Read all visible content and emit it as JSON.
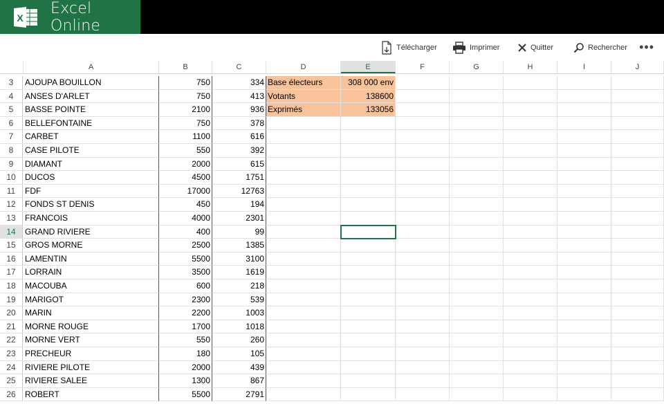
{
  "app": {
    "title": "Excel Online",
    "brand_color": "#217346"
  },
  "toolbar": {
    "download_label": "Télécharger",
    "print_label": "Imprimer",
    "quit_label": "Quitter",
    "search_label": "Rechercher",
    "more_label": "•••"
  },
  "sheet": {
    "columns": [
      "A",
      "B",
      "C",
      "D",
      "E",
      "F",
      "G",
      "H",
      "I",
      "J"
    ],
    "selected_cell": "E14",
    "rows": [
      {
        "n": "3",
        "a": "AJOUPA BOUILLON",
        "b": "750",
        "c": "334",
        "d": "Base électeurs",
        "e": "308 000 env"
      },
      {
        "n": "4",
        "a": "ANSES D'ARLET",
        "b": "750",
        "c": "413",
        "d": "Votants",
        "e": "138600"
      },
      {
        "n": "5",
        "a": "BASSE POINTE",
        "b": "2100",
        "c": "936",
        "d": "Exprimés",
        "e": "133056"
      },
      {
        "n": "6",
        "a": "BELLEFONTAINE",
        "b": "750",
        "c": "378",
        "d": "",
        "e": ""
      },
      {
        "n": "7",
        "a": "CARBET",
        "b": "1100",
        "c": "616",
        "d": "",
        "e": ""
      },
      {
        "n": "8",
        "a": "CASE PILOTE",
        "b": "550",
        "c": "392",
        "d": "",
        "e": ""
      },
      {
        "n": "9",
        "a": "DIAMANT",
        "b": "2000",
        "c": "615",
        "d": "",
        "e": ""
      },
      {
        "n": "10",
        "a": "DUCOS",
        "b": "4500",
        "c": "1751",
        "d": "",
        "e": ""
      },
      {
        "n": "11",
        "a": "FDF",
        "b": "17000",
        "c": "12763",
        "d": "",
        "e": ""
      },
      {
        "n": "12",
        "a": "FONDS ST DENIS",
        "b": "450",
        "c": "194",
        "d": "",
        "e": ""
      },
      {
        "n": "13",
        "a": "FRANCOIS",
        "b": "4000",
        "c": "2301",
        "d": "",
        "e": ""
      },
      {
        "n": "14",
        "a": "GRAND RIVIERE",
        "b": "400",
        "c": "99",
        "d": "",
        "e": ""
      },
      {
        "n": "15",
        "a": "GROS MORNE",
        "b": "2500",
        "c": "1385",
        "d": "",
        "e": ""
      },
      {
        "n": "16",
        "a": "LAMENTIN",
        "b": "5500",
        "c": "3100",
        "d": "",
        "e": ""
      },
      {
        "n": "17",
        "a": "LORRAIN",
        "b": "3500",
        "c": "1619",
        "d": "",
        "e": ""
      },
      {
        "n": "18",
        "a": "MACOUBA",
        "b": "600",
        "c": "218",
        "d": "",
        "e": ""
      },
      {
        "n": "19",
        "a": "MARIGOT",
        "b": "2300",
        "c": "539",
        "d": "",
        "e": ""
      },
      {
        "n": "20",
        "a": "MARIN",
        "b": "2200",
        "c": "1003",
        "d": "",
        "e": ""
      },
      {
        "n": "21",
        "a": "MORNE ROUGE",
        "b": "1700",
        "c": "1018",
        "d": "",
        "e": ""
      },
      {
        "n": "22",
        "a": "MORNE VERT",
        "b": "550",
        "c": "260",
        "d": "",
        "e": ""
      },
      {
        "n": "23",
        "a": "PRECHEUR",
        "b": "180",
        "c": "105",
        "d": "",
        "e": ""
      },
      {
        "n": "24",
        "a": "RIVIERE PILOTE",
        "b": "2000",
        "c": "439",
        "d": "",
        "e": ""
      },
      {
        "n": "25",
        "a": "RIVIERE SALEE",
        "b": "1300",
        "c": "867",
        "d": "",
        "e": ""
      },
      {
        "n": "26",
        "a": "ROBERT",
        "b": "5500",
        "c": "2791",
        "d": "",
        "e": ""
      }
    ],
    "highlight_color": "#f8c29a"
  }
}
